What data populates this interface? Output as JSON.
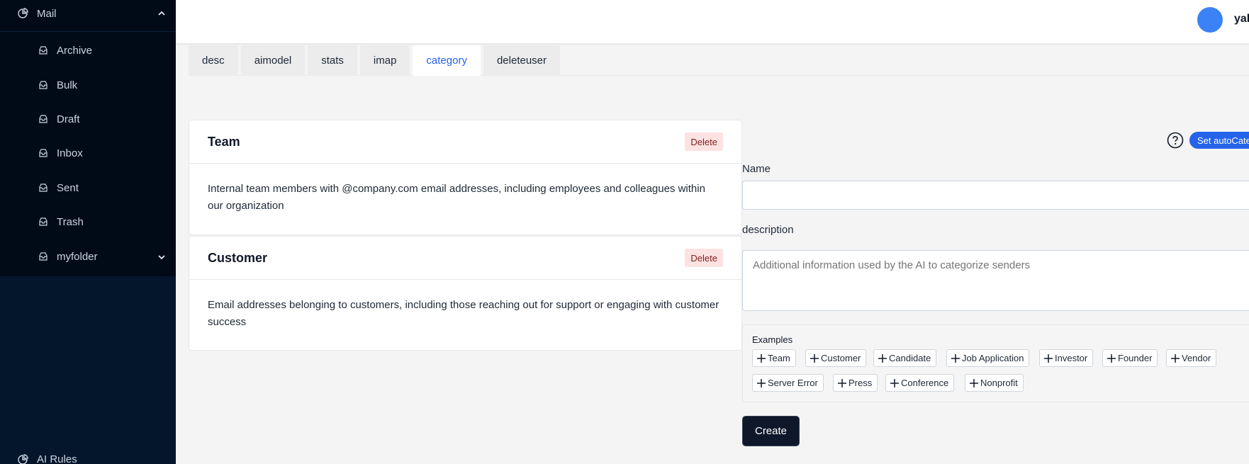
{
  "sidebar": {
    "mail_label": "Mail",
    "items": [
      {
        "label": "Archive"
      },
      {
        "label": "Bulk"
      },
      {
        "label": "Draft"
      },
      {
        "label": "Inbox"
      },
      {
        "label": "Sent"
      },
      {
        "label": "Trash"
      },
      {
        "label": "myfolder"
      }
    ],
    "ai_rules_label": "AI Rules"
  },
  "header": {
    "username": "yak",
    "avatar_color": "#3b82f6"
  },
  "tabs": [
    {
      "label": "desc"
    },
    {
      "label": "aimodel"
    },
    {
      "label": "stats"
    },
    {
      "label": "imap"
    },
    {
      "label": "category",
      "active": true
    },
    {
      "label": "deleteuser"
    }
  ],
  "categories": [
    {
      "title": "Team",
      "delete_label": "Delete",
      "description": "Internal team members with @company.com email addresses, including employees and colleagues within our organization"
    },
    {
      "title": "Customer",
      "delete_label": "Delete",
      "description": "Email addresses belonging to customers, including those reaching out for support or engaging with customer success"
    }
  ],
  "form": {
    "help_icon": "question-circle-icon",
    "autocat_label": "Set autoCategorize",
    "name_label": "Name",
    "name_value": "",
    "description_label": "description",
    "description_placeholder": "Additional information used by the AI to categorize senders",
    "examples_title": "Examples",
    "examples": [
      "Team",
      "Customer",
      "Candidate",
      "Job Application",
      "Investor",
      "Founder",
      "Vendor",
      "Server Error",
      "Press",
      "Conference",
      "Nonprofit"
    ],
    "create_label": "Create"
  },
  "colors": {
    "sidebar_bg": "#04162c",
    "accent": "#2563eb",
    "delete_bg": "#fde2e2",
    "create_bg": "#0f172a"
  }
}
